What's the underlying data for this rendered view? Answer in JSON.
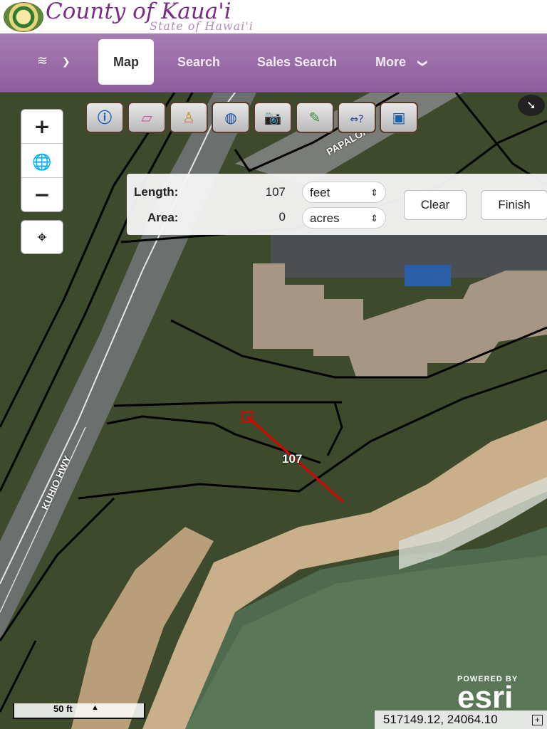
{
  "header": {
    "title": "County of Kaua'i",
    "subtitle": "State of Hawai'i"
  },
  "nav": {
    "layers_icon": "layers-icon",
    "tabs": [
      {
        "label": "Map",
        "active": true
      },
      {
        "label": "Search",
        "active": false
      },
      {
        "label": "Sales Search",
        "active": false
      },
      {
        "label": "More",
        "active": false
      }
    ]
  },
  "map_controls": {
    "zoom_in": "+",
    "zoom_out": "−",
    "home_icon": "globe-icon",
    "locate_icon": "locate-crosshair-icon"
  },
  "toolbar": {
    "tools": [
      "info-icon",
      "eraser-icon",
      "street-view-icon",
      "globe-basemap-icon",
      "camera-icon",
      "draw-icon",
      "measure-icon",
      "print-icon"
    ]
  },
  "measure": {
    "length_label": "Length:",
    "length_value": "107",
    "length_unit": "feet",
    "area_label": "Area:",
    "area_value": "0",
    "area_unit": "acres",
    "clear_label": "Clear",
    "finish_label": "Finish"
  },
  "map": {
    "road_label_1": "KUHIO HWY",
    "road_label_2": "PAPALOA",
    "measure_label": "107"
  },
  "footer": {
    "scale_label": "50 ft",
    "powered_by": "POWERED BY",
    "esri": "esri",
    "coordinates": "517149.12, 24064.10"
  },
  "colors": {
    "nav_purple": "#9a6aa8",
    "brand_purple": "#7b2c86",
    "measure_line": "#e00000"
  }
}
